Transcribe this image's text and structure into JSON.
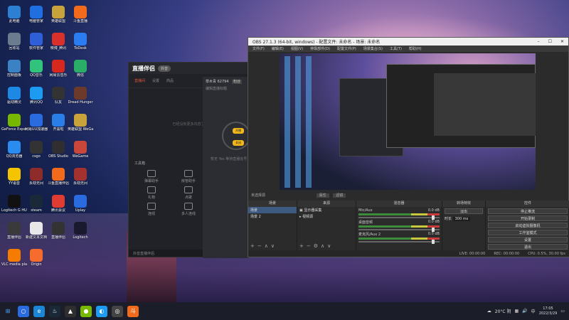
{
  "desktop_icons": [
    {
      "label": "此电脑",
      "color": "#2d7fd3"
    },
    {
      "label": "电脑管家",
      "color": "#1f6fe0"
    },
    {
      "label": "英雄联盟",
      "color": "#c8a23a"
    },
    {
      "label": "斗鱼直播",
      "color": "#f26b1d"
    },
    {
      "label": "回收站",
      "color": "#6a7c8e"
    },
    {
      "label": "软件管家",
      "color": "#2f5fd6"
    },
    {
      "label": "微博_腾讯",
      "color": "#d9302c"
    },
    {
      "label": "ToDesk",
      "color": "#2a7cf0"
    },
    {
      "label": "控制面板",
      "color": "#3b82c4"
    },
    {
      "label": "QQ音乐",
      "color": "#31c27c"
    },
    {
      "label": "网易云音乐",
      "color": "#d8271d"
    },
    {
      "label": "微信",
      "color": "#2aae67"
    },
    {
      "label": "驱动精灵",
      "color": "#1e88e5"
    },
    {
      "label": "腾讯QQ",
      "color": "#1d9bf0"
    },
    {
      "label": "队友",
      "color": "#333"
    },
    {
      "label": "Dread Hunger",
      "color": "#6b3a2a"
    },
    {
      "label": "GeForce Experience",
      "color": "#76b900"
    },
    {
      "label": "网易UU加速器",
      "color": "#2b6be0"
    },
    {
      "label": "开黑啦",
      "color": "#2a7ee8"
    },
    {
      "label": "英雄联盟 WeGame版",
      "color": "#c8a23a"
    },
    {
      "label": "QQ浏览器",
      "color": "#2b8cf0"
    },
    {
      "label": "csgo",
      "color": "#333"
    },
    {
      "label": "OBS Studio",
      "color": "#302e31"
    },
    {
      "label": "WeGame",
      "color": "#c8473a"
    },
    {
      "label": "YY语音",
      "color": "#f5c400"
    },
    {
      "label": "永劫无间",
      "color": "#8e2b2b"
    },
    {
      "label": "斗鱼直播伴侣",
      "color": "#f26b1d"
    },
    {
      "label": "永劫无间",
      "color": "#a3322e"
    },
    {
      "label": "Logitech G HUB",
      "color": "#111"
    },
    {
      "label": "steam",
      "color": "#1b2838"
    },
    {
      "label": "腾讯会议",
      "color": "#e03c31"
    },
    {
      "label": "Uplay",
      "color": "#2a6be0"
    },
    {
      "label": "直播伴侣",
      "color": "#3a3a3a"
    },
    {
      "label": "新建文本文档",
      "color": "#e8e8e8"
    },
    {
      "label": "直播伴侣",
      "color": "#333"
    },
    {
      "label": "Logitech",
      "color": "#1a1a2e"
    },
    {
      "label": "VLC media player",
      "color": "#f57c00"
    },
    {
      "label": "Origin",
      "color": "#f56c2d"
    }
  ],
  "douyin": {
    "logo": "直播伴侣",
    "badge": "抖音",
    "tabs": [
      "直播间",
      "设置",
      "商品"
    ],
    "empty_text": "已经没有更多内容了",
    "tools_title": "工具箱",
    "tools": [
      "弹幕助手",
      "房管助手",
      "主播任务",
      "礼物",
      "点歌",
      "PK",
      "连线",
      "多人连线",
      "更多"
    ],
    "anchor": "草木青 62794",
    "anchor_badge": "粉丝",
    "edit_hint": "编辑直播标题",
    "yellow_btn1": "开播",
    "yellow_btn2": "关闭",
    "hint": "暂无 Yes 等待直播信号",
    "bottom": "抖音直播伴侣"
  },
  "obs": {
    "title": "OBS 27.1.3 (64-bit, windows) - 配置文件: 未命名 - 场景: 未命名",
    "menu": [
      "文件(F)",
      "编辑(E)",
      "视图(V)",
      "停靠部件(D)",
      "配置文件(P)",
      "场景集合(S)",
      "工具(T)",
      "帮助(H)"
    ],
    "scene_label": "未选择源",
    "props_btn": "属性",
    "filter_btn": "滤镜",
    "docks": {
      "scenes": "场景",
      "sources": "来源",
      "mixer": "混音器",
      "transitions": "转场特效",
      "controls": "控件"
    },
    "scenes": [
      "场景",
      "场景 2"
    ],
    "sources": [
      "显示器采集",
      "视频源"
    ],
    "mixer": [
      {
        "name": "Mic/Aux",
        "db": "0.0 dB"
      },
      {
        "name": "桌面音频",
        "db": "0.0 dB"
      },
      {
        "name": "麦克风/Aux 2",
        "db": "0.0 dB"
      }
    ],
    "transition": "淡出",
    "duration_label": "时长",
    "duration": "300 ms",
    "controls": [
      "停止推流",
      "开始录制",
      "启动虚拟摄像机",
      "工作室模式",
      "设置",
      "退出"
    ],
    "status": {
      "live": "LIVE: 00:00:00",
      "rec": "REC: 00:00:00",
      "cpu": "CPU: 0.5%, 30.00 fps"
    }
  },
  "taskbar": {
    "weather": "20°C 阴",
    "ime": "中",
    "time": "17:05",
    "date": "2022/3/29"
  }
}
